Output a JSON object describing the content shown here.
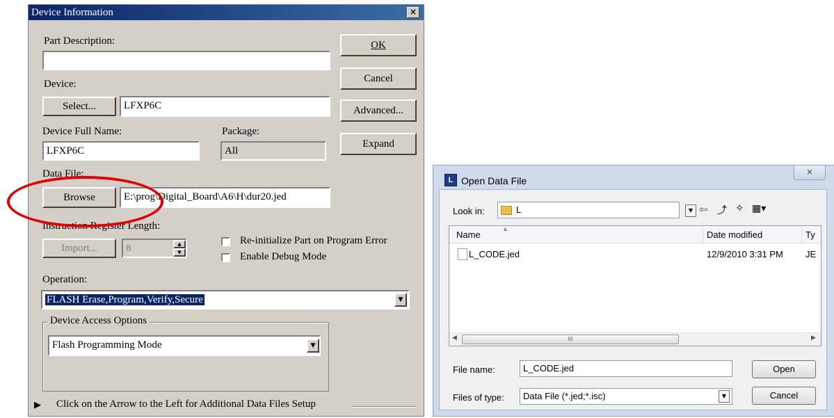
{
  "device_dialog": {
    "title": "Device Information",
    "close_glyph": "×",
    "part_description_label": "Part Description:",
    "part_description_value": "",
    "device_label": "Device:",
    "select_button": "Select...",
    "device_value": "LFXP6C",
    "full_name_label": "Device Full Name:",
    "full_name_value": "LFXP6C",
    "package_label": "Package:",
    "package_value": "All",
    "data_file_label": "Data File:",
    "browse_button": "Browse",
    "data_file_value": "E:\\prog\\Digital_Board\\A6\\H\\dur20.jed",
    "ir_length_label": "Instruction Register Length:",
    "import_button": "Import...",
    "ir_length_value": "8",
    "reinit_label": "Re-initialize Part on Program Error",
    "debug_label": "Enable Debug Mode",
    "operation_label": "Operation:",
    "operation_value": "FLASH Erase,Program,Verify,Secure",
    "access_group_label": "Device Access Options",
    "access_value": "Flash Programming Mode",
    "additional_text": "Click on the Arrow to the Left for Additional Data Files Setup",
    "ok_button": "OK",
    "cancel_button": "Cancel",
    "advanced_button": "Advanced...",
    "expand_button": "Expand",
    "highlight_color": "#e00000"
  },
  "open_dialog": {
    "title": "Open Data File",
    "close_glyph": "✕",
    "look_in_label": "Look in:",
    "look_in_value": "L",
    "columns": [
      "Name",
      "Date modified",
      "Ty"
    ],
    "files": [
      {
        "name": "L_CODE.jed",
        "date": "12/9/2010 3:31 PM",
        "type": "JE"
      }
    ],
    "file_name_label": "File name:",
    "file_name_value": "L_CODE.jed",
    "file_type_label": "Files of type:",
    "file_type_value": "Data File (*.jed;*.isc)",
    "open_button": "Open",
    "cancel_button": "Cancel",
    "scroll_thumb_glyph": "III"
  }
}
